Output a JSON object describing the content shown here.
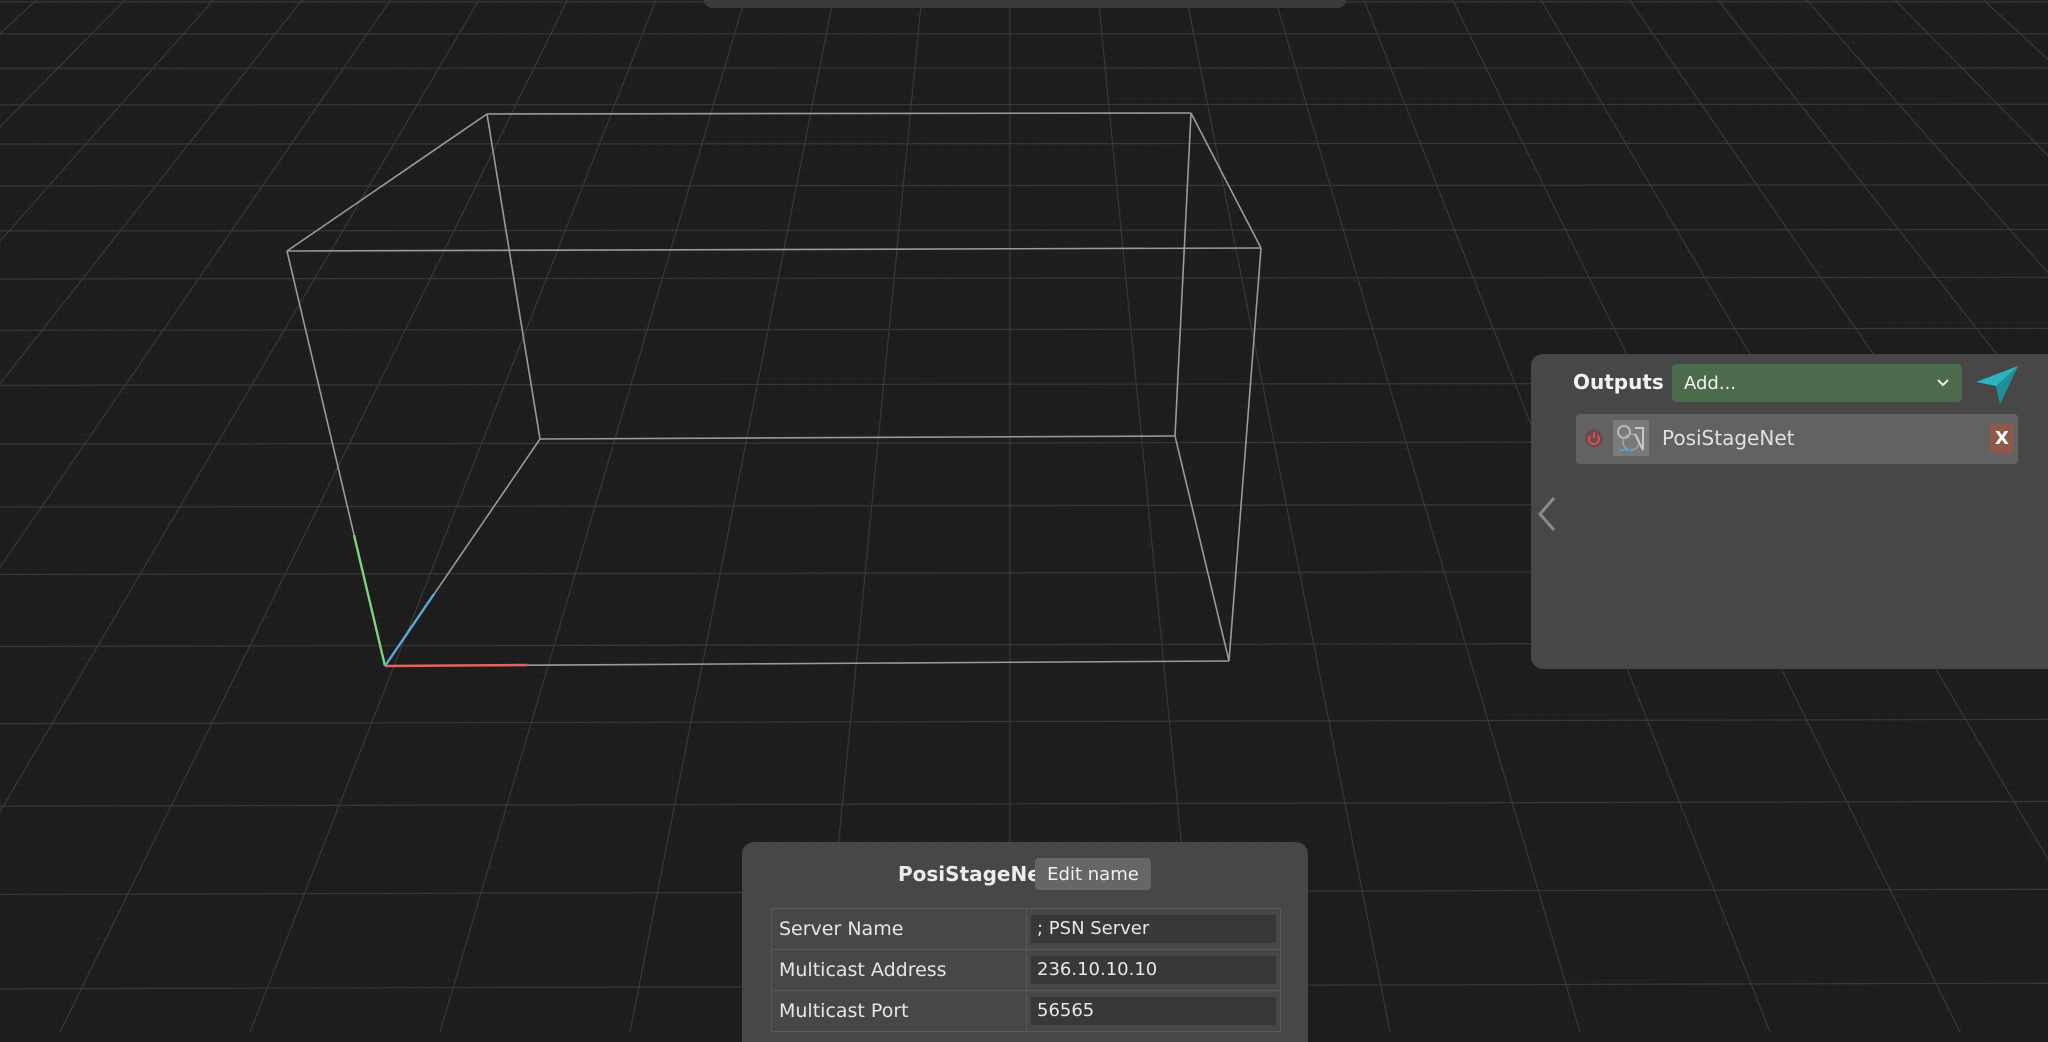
{
  "outputs_panel": {
    "title": "Outputs",
    "add_select": {
      "value": "Add...",
      "color": "#4c6a4c"
    },
    "items": [
      {
        "name": "PosiStageNet",
        "remove_label": "X",
        "power_icon": "power-icon",
        "logo_icon": "psn-logo-icon"
      }
    ]
  },
  "properties_panel": {
    "title": "PosiStageNet",
    "edit_name_label": "Edit name",
    "fields": [
      {
        "label": "Server Name",
        "value": "; PSN Server"
      },
      {
        "label": "Multicast Address",
        "value": "236.10.10.10"
      },
      {
        "label": "Multicast Port",
        "value": "56565"
      }
    ]
  },
  "colors": {
    "background": "#1d1d1d",
    "panel": "#474747",
    "axis_x": "#e06666",
    "axis_y": "#7fd27f",
    "axis_z": "#5fa8d3",
    "send_icon": "#2bb3c0"
  }
}
